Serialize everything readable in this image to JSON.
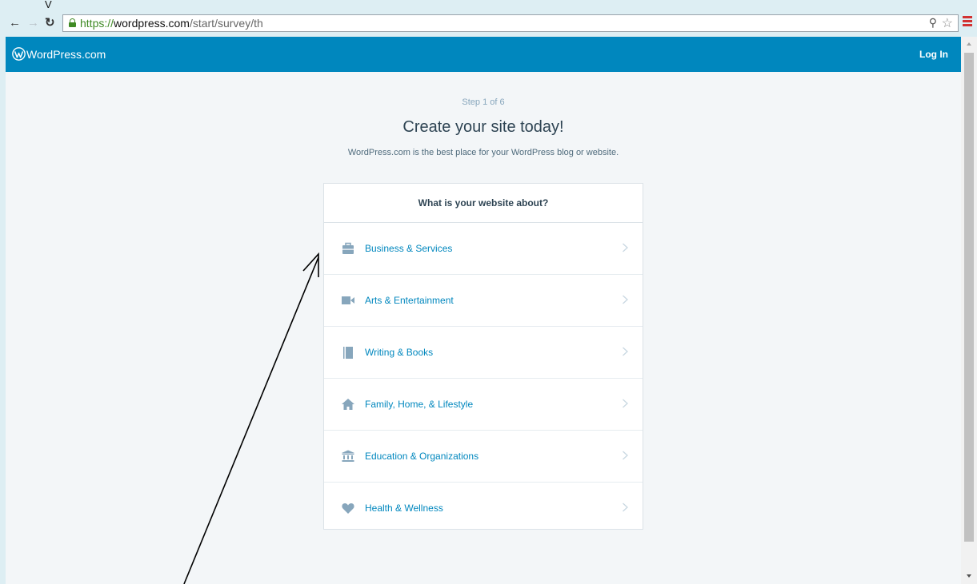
{
  "browser": {
    "tab_stub": "V",
    "url": {
      "scheme": "https://",
      "host": "wordpress.com",
      "path": "/start/survey/th"
    },
    "icons": {
      "back": "back-arrow-icon",
      "forward": "forward-arrow-icon",
      "reload": "reload-icon",
      "lock": "lock-icon",
      "zoom": "zoom-icon",
      "star": "bookmark-star-icon",
      "menu": "menu-icon"
    }
  },
  "header": {
    "brand": "WordPress.com",
    "login": "Log In",
    "bg_color": "#0087be"
  },
  "main": {
    "step": "Step 1 of 6",
    "headline": "Create your site today!",
    "subhead": "WordPress.com is the best place for your WordPress blog or website.",
    "card_title": "What is your website about?",
    "categories": [
      {
        "label": "Business & Services",
        "icon": "briefcase-icon"
      },
      {
        "label": "Arts & Entertainment",
        "icon": "video-camera-icon"
      },
      {
        "label": "Writing & Books",
        "icon": "book-icon"
      },
      {
        "label": "Family, Home, & Lifestyle",
        "icon": "house-icon"
      },
      {
        "label": "Education & Organizations",
        "icon": "institution-icon"
      },
      {
        "label": "Health & Wellness",
        "icon": "heart-icon"
      }
    ]
  },
  "colors": {
    "accent": "#0087be",
    "icon_gray": "#87a6bc",
    "text_dark": "#2e4453",
    "secure_green": "#3f8a24",
    "menu_red": "#d23232"
  }
}
